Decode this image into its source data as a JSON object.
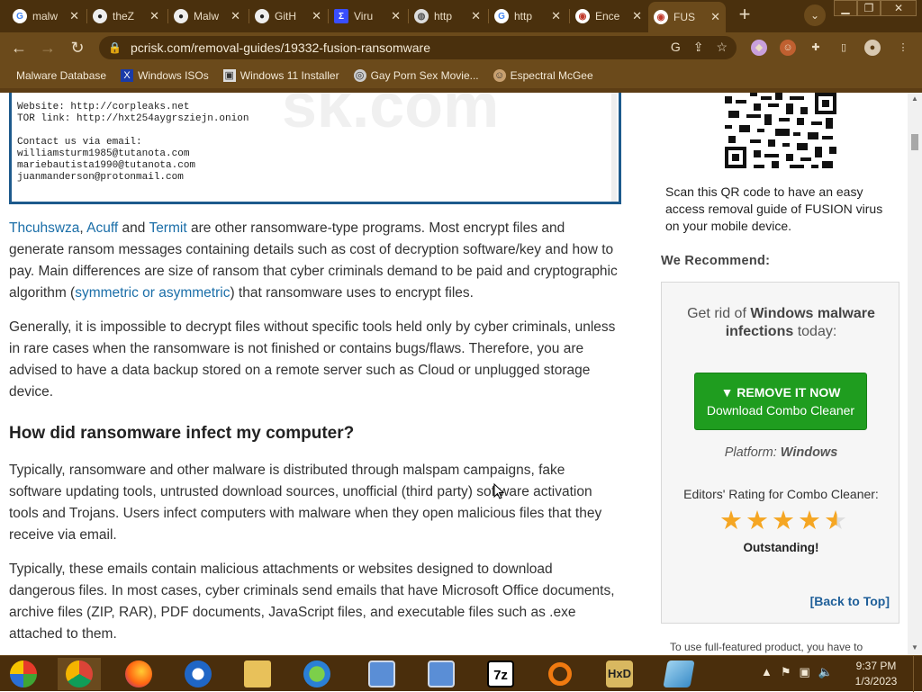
{
  "browser": {
    "tabs": [
      {
        "title": "malw",
        "icon": "google"
      },
      {
        "title": "theZ",
        "icon": "github"
      },
      {
        "title": "Malw",
        "icon": "github"
      },
      {
        "title": "GitH",
        "icon": "github"
      },
      {
        "title": "Viru",
        "icon": "virustotal"
      },
      {
        "title": "http",
        "icon": "globe"
      },
      {
        "title": "http",
        "icon": "google"
      },
      {
        "title": "Ence",
        "icon": "pcrisk"
      },
      {
        "title": "FUS",
        "icon": "pcrisk",
        "active": true
      }
    ],
    "new_tab": "+",
    "url": "pcrisk.com/removal-guides/19332-fusion-ransomware",
    "bookmarks": [
      "Malware Database",
      "Windows ISOs",
      "Windows 11 Installer",
      "Gay Porn Sex Movie...",
      "Espectral McGee"
    ]
  },
  "ransom_note": {
    "lines": [
      "Website: http://corpleaks.net",
      "TOR link: http://hxt254aygrsziejn.onion",
      "",
      "Contact us via email:",
      "williamsturm1985@tutanota.com",
      "mariebautista1990@tutanota.com",
      "juanmanderson@protonmail.com"
    ],
    "watermark": "sk.com"
  },
  "article": {
    "p1_links": [
      "Thcuhswza",
      "Acuff",
      "Termit"
    ],
    "p1_and": "and",
    "p1_text": "are other ransomware-type programs. Most encrypt files and generate ransom messages containing details such as cost of decryption software/key and how to pay. Main differences are size of ransom that cyber criminals demand to be paid and cryptographic algorithm (",
    "p1_link2": "symmetric or asymmetric",
    "p1_end": ") that ransomware uses to encrypt files.",
    "p2": "Generally, it is impossible to decrypt files without specific tools held only by cyber criminals, unless in rare cases when the ransomware is not finished or contains bugs/flaws. Therefore, you are advised to have a data backup stored on a remote server such as Cloud or unplugged storage device.",
    "heading": "How did ransomware infect my computer?",
    "p3": "Typically, ransomware and other malware is distributed through malspam campaigns, fake software updating tools, untrusted download sources, unofficial (third party) software activation tools and Trojans. Users infect computers with malware when they open malicious files that they receive via email.",
    "p4": "Typically, these emails contain malicious attachments or websites designed to download dangerous files. In most cases, cyber criminals send emails that have Microsoft Office documents, archive files (ZIP, RAR), PDF documents, JavaScript files, and executable files such as .exe attached to them."
  },
  "sidebar": {
    "qr_text": "Scan this QR code to have an easy access removal guide of FUSION virus on your mobile device.",
    "recommend": "We Recommend:",
    "get_rid_1": "Get rid of",
    "get_rid_bold": "Windows malware infections",
    "get_rid_2": "today:",
    "remove_l1": "▼ REMOVE IT NOW",
    "remove_l2": "Download Combo Cleaner",
    "platform_label": "Platform:",
    "platform_value": "Windows",
    "rating_label": "Editors' Rating for Combo Cleaner:",
    "rating_value": 4.5,
    "rating_text": "Outstanding!",
    "back_to_top": "[Back to Top]",
    "full_featured": "To use full-featured product, you have to"
  },
  "taskbar": {
    "apps": [
      "windows-start",
      "chrome",
      "firefox",
      "edge",
      "file-explorer",
      "network",
      "vm-1",
      "vm-2",
      "7zip",
      "search-tool",
      "hxd",
      "notepad"
    ],
    "time": "9:37 PM",
    "date": "1/3/2023"
  },
  "colors": {
    "accent": "#1a6ea8",
    "button_green": "#1f9d1f",
    "chrome_brown": "#5c3d14",
    "star": "#f5a623"
  }
}
